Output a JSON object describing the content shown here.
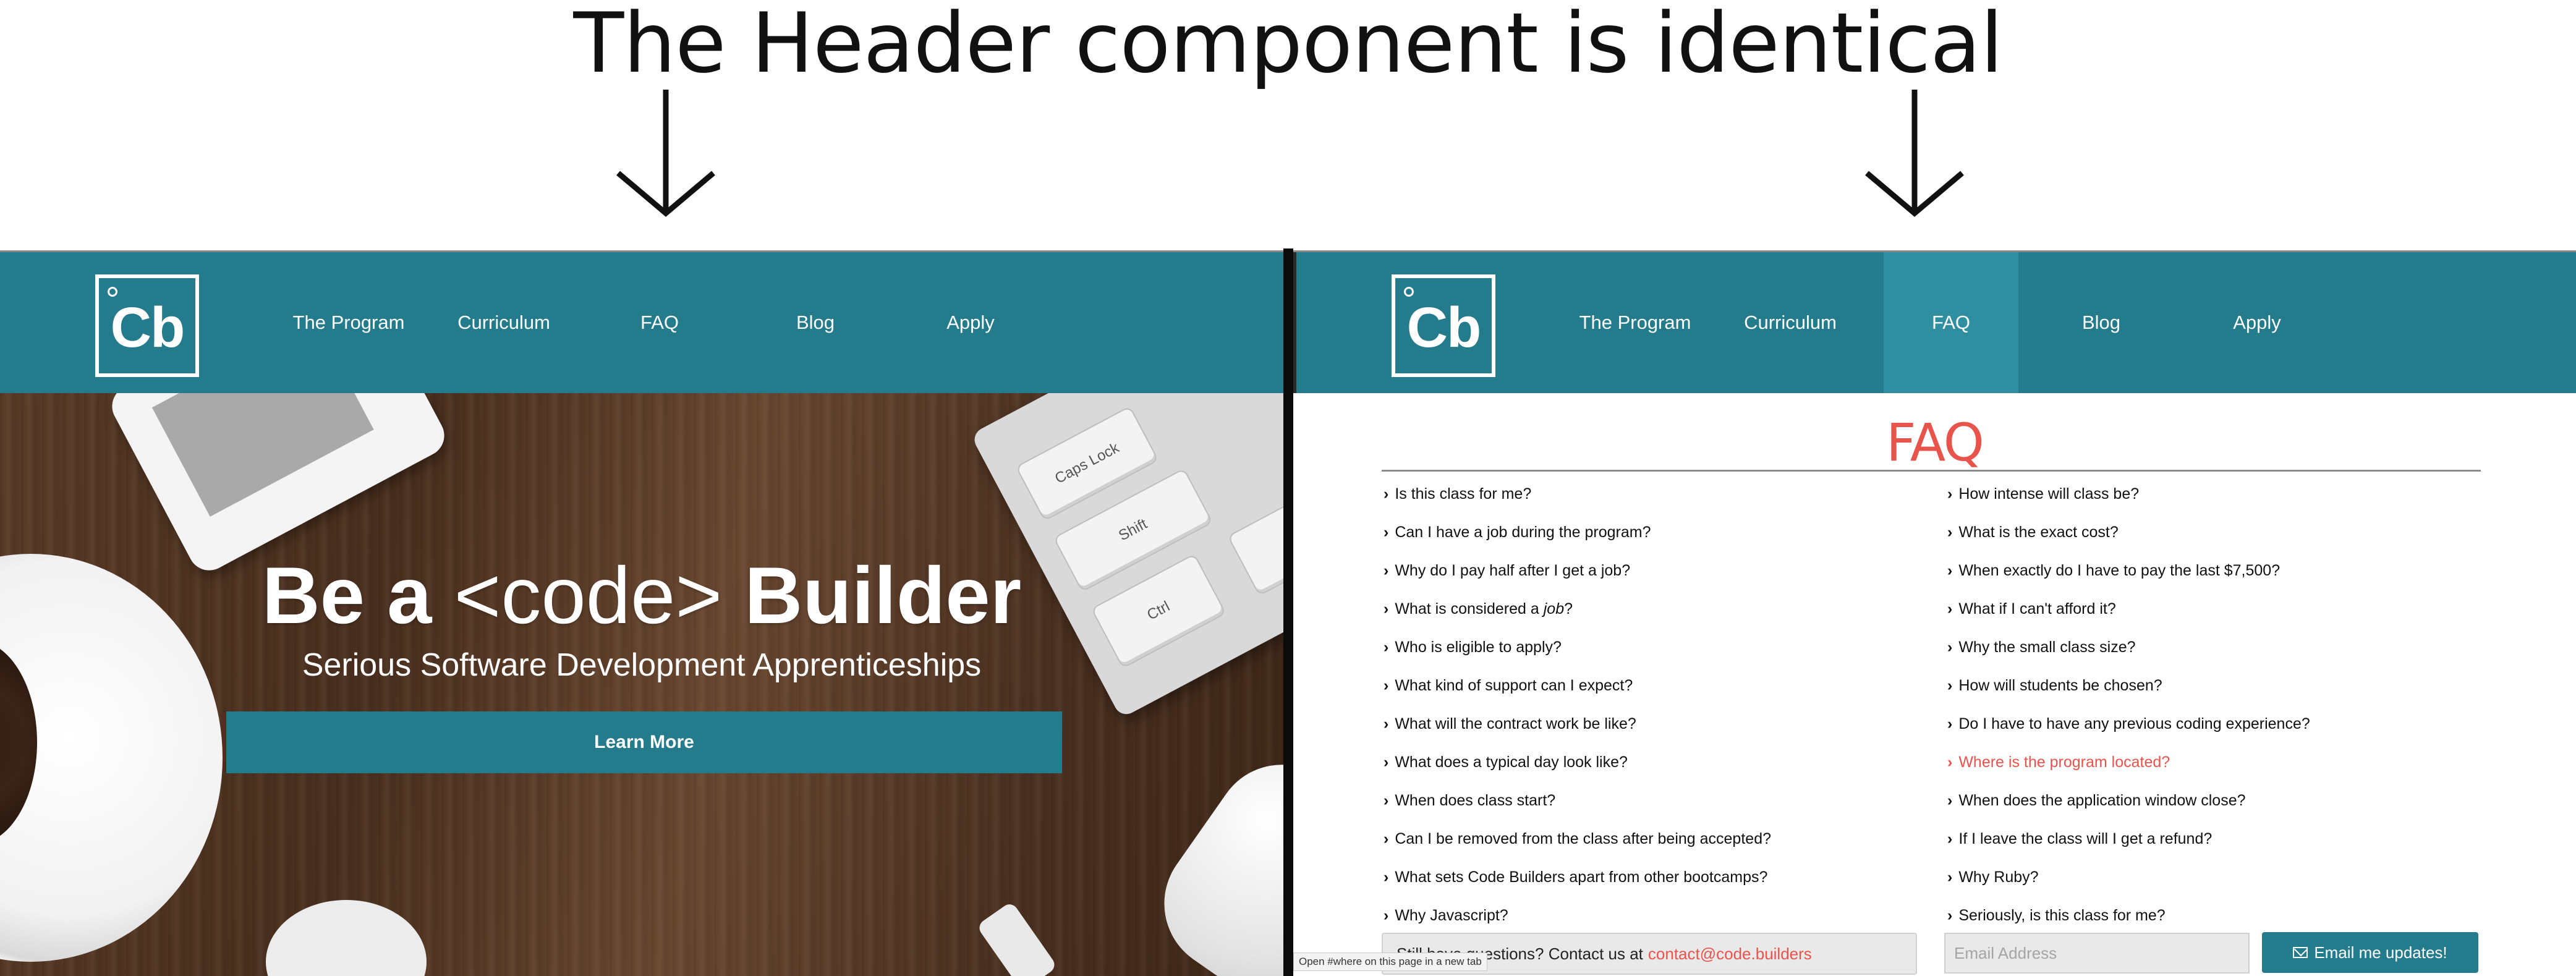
{
  "annotation": {
    "caption": "The Header component is identical"
  },
  "header": {
    "logo_text": "Cb",
    "nav": [
      {
        "label": "The Program"
      },
      {
        "label": "Curriculum"
      },
      {
        "label": "FAQ"
      },
      {
        "label": "Blog"
      },
      {
        "label": "Apply"
      }
    ],
    "active_nav_right": "FAQ",
    "color": "#237b8c",
    "active_color": "#2f8fa1"
  },
  "hero": {
    "title_be_a": "Be a",
    "title_code": "<code>",
    "title_builder": "Builder",
    "subtitle": "Serious Software Development Apprenticeships",
    "button_label": "Learn More",
    "keys": [
      "Caps Lock",
      "Shift",
      "Ctrl"
    ]
  },
  "faq": {
    "title": "FAQ",
    "left": [
      "Is this class for me?",
      "Can I have a job during the program?",
      "Why do I pay half after I get a job?",
      "What is considered a",
      "Who is eligible to apply?",
      "What kind of support can I expect?",
      "What will the contract work be like?",
      "What does a typical day look like?",
      "When does class start?",
      "Can I be removed from the class after being accepted?",
      "What sets Code Builders apart from other bootcamps?",
      "Why Javascript?"
    ],
    "left_emphasis_word": "job",
    "left_emphasis_suffix": "?",
    "right": [
      "How intense will class be?",
      "What is the exact cost?",
      "When exactly do I have to pay the last $7,500?",
      "What if I can't afford it?",
      "Why the small class size?",
      "How will students be chosen?",
      "Do I have to have any previous coding experience?",
      "Where is the program located?",
      "When does the application window close?",
      "If I leave the class will I get a refund?",
      "Why Ruby?",
      "Seriously, is this class for me?"
    ],
    "active_question": "Where is the program located?",
    "accent_color": "#e8534c"
  },
  "footer": {
    "contact_text": "Still have questions? Contact us at",
    "contact_email": "contact@code.builders",
    "email_placeholder": "Email Address",
    "email_button": "Email me updates!",
    "status_tip": "Open #where on this page in a new tab"
  }
}
